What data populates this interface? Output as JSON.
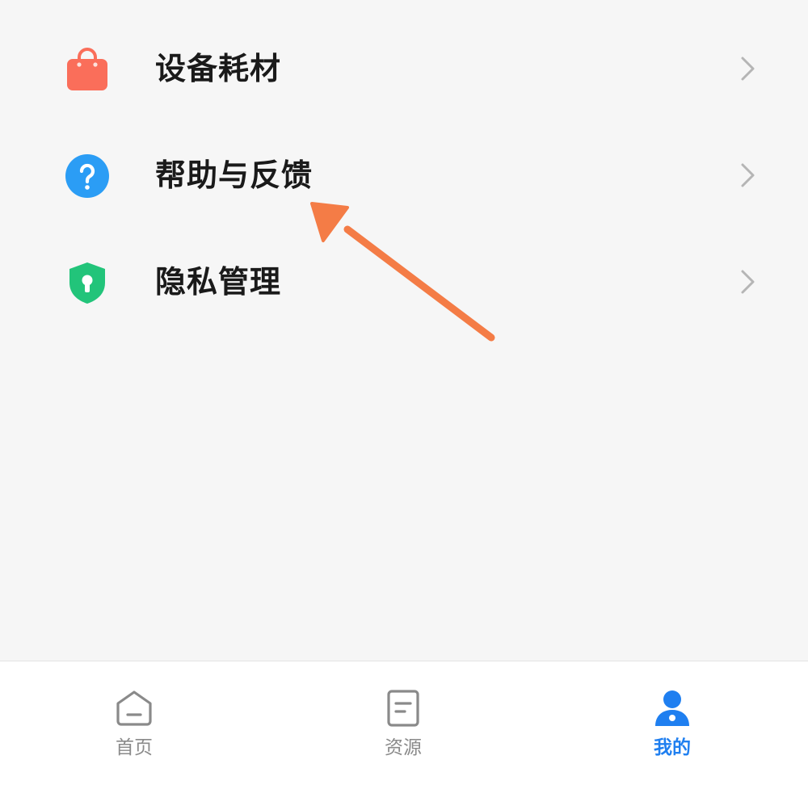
{
  "menu": {
    "items": [
      {
        "label": "设备耗材",
        "icon": "shopping-bag-icon",
        "color": "#fa6e5a"
      },
      {
        "label": "帮助与反馈",
        "icon": "help-question-icon",
        "color": "#2b9df5"
      },
      {
        "label": "隐私管理",
        "icon": "shield-lock-icon",
        "color": "#22c47a"
      }
    ],
    "chevron_color": "#b5b5b5"
  },
  "annotation": {
    "arrow_color": "#f47c46",
    "points_to": "帮助与反馈"
  },
  "tabbar": {
    "tabs": [
      {
        "label": "首页",
        "icon": "home-icon",
        "active": false
      },
      {
        "label": "资源",
        "icon": "document-icon",
        "active": false
      },
      {
        "label": "我的",
        "icon": "user-icon",
        "active": true
      }
    ],
    "active_color": "#1f7ff0",
    "inactive_color": "#8a8a8a"
  }
}
